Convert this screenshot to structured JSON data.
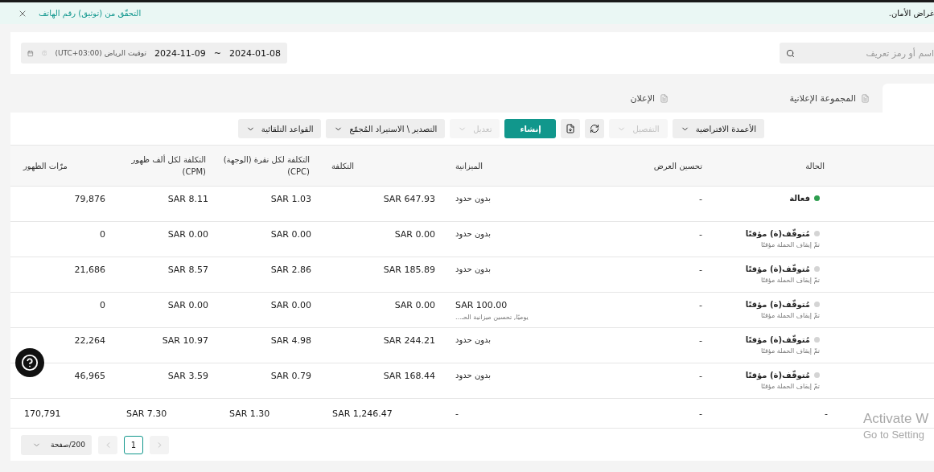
{
  "notice_banner": {
    "link": "التحقّق من (توثيق) رقم الهاتف",
    "message": "غراض الأمان."
  },
  "filters": {
    "search": {
      "placeholder": "اسم أو رمز تعريف"
    },
    "date_range": {
      "start": "2024-01-08",
      "separator": "~",
      "end": "2024-11-09",
      "timezone": "توقيت الرياض (UTC+03:00)"
    }
  },
  "tabs": [
    {
      "selected": true
    },
    {
      "label": "المجموعة الإعلانية",
      "selected": false
    },
    {
      "label": "الإعلان",
      "selected": false
    }
  ],
  "toolbar": [
    {
      "kind": "dropdown",
      "label": "الأعمدة الافتراضية",
      "disabled": false
    },
    {
      "kind": "dropdown",
      "label": "التفصيل",
      "disabled": true
    },
    {
      "kind": "refresh",
      "disabled": false
    },
    {
      "kind": "download",
      "disabled": false
    },
    {
      "kind": "primary",
      "label": "إنشاء"
    },
    {
      "kind": "dropdown",
      "label": "تعديل",
      "disabled": true
    },
    {
      "kind": "dropdown",
      "label": "التصدير \\ الاستيراد المُجمّع",
      "disabled": false
    },
    {
      "kind": "dropdown",
      "label": "القواعد التلقائية",
      "disabled": false
    }
  ],
  "table": {
    "columns": [
      "الحالة",
      "تحسين العرض",
      "الميزانية",
      "التكلفة",
      "التكلفة لكل نقرة (الوجهة) (CPC)",
      "التكلفة لكل ألف ظهور (CPM)",
      "مرّات الظهور"
    ],
    "rows": [
      {
        "status": {
          "label": "فعالة",
          "color": "#2e9e4f"
        },
        "optimization": "-",
        "budget": {
          "amount": "بدون حدود"
        },
        "cost": "SAR 647.93",
        "cpc": "SAR 1.03",
        "cpm": "SAR 8.11",
        "impressions": "79,876"
      },
      {
        "status": {
          "label": "مُتوقّف(ة) مؤقتًا",
          "note": "تمّ إيقاف الحملة مؤقتًا",
          "color": "#d4d4d4"
        },
        "optimization": "-",
        "budget": {
          "amount": "بدون حدود"
        },
        "cost": "SAR 0.00",
        "cpc": "SAR 0.00",
        "cpm": "SAR 0.00",
        "impressions": "0"
      },
      {
        "status": {
          "label": "مُتوقّف(ة) مؤقتًا",
          "note": "تمّ إيقاف الحملة مؤقتًا",
          "color": "#d4d4d4"
        },
        "optimization": "-",
        "budget": {
          "amount": "بدون حدود"
        },
        "cost": "SAR 185.89",
        "cpc": "SAR 2.86",
        "cpm": "SAR 8.57",
        "impressions": "21,686"
      },
      {
        "status": {
          "label": "مُتوقّف(ة) مؤقتًا",
          "note": "تمّ إيقاف الحملة مؤقتًا",
          "color": "#d4d4d4"
        },
        "optimization": "-",
        "budget": {
          "amount": "SAR 100.00",
          "note": "يوميًا, تحسين ميزانية الحـ..."
        },
        "cost": "SAR 0.00",
        "cpc": "SAR 0.00",
        "cpm": "SAR 0.00",
        "impressions": "0"
      },
      {
        "status": {
          "label": "مُتوقّف(ة) مؤقتًا",
          "note": "تمّ إيقاف الحملة مؤقتًا",
          "color": "#d4d4d4"
        },
        "optimization": "-",
        "budget": {
          "amount": "بدون حدود"
        },
        "cost": "SAR 244.21",
        "cpc": "SAR 4.98",
        "cpm": "SAR 10.97",
        "impressions": "22,264"
      },
      {
        "status": {
          "label": "مُتوقّف(ة) مؤقتًا",
          "note": "تمّ إيقاف الحملة مؤقتًا",
          "color": "#d4d4d4"
        },
        "optimization": "-",
        "budget": {
          "amount": "بدون حدود"
        },
        "cost": "SAR 168.44",
        "cpc": "SAR 0.79",
        "cpm": "SAR 3.59",
        "impressions": "46,965"
      }
    ],
    "totals": [
      "-",
      "-",
      "-",
      "SAR 1,246.47",
      "SAR 1.30",
      "SAR 7.30",
      "170,791"
    ]
  },
  "pagination": {
    "page_size": "200/صفحة",
    "pages": [
      {
        "label": "1",
        "selected": true
      }
    ]
  },
  "os_overlay": {
    "line_1": "Activate W",
    "line_2": "Go to Setting"
  }
}
